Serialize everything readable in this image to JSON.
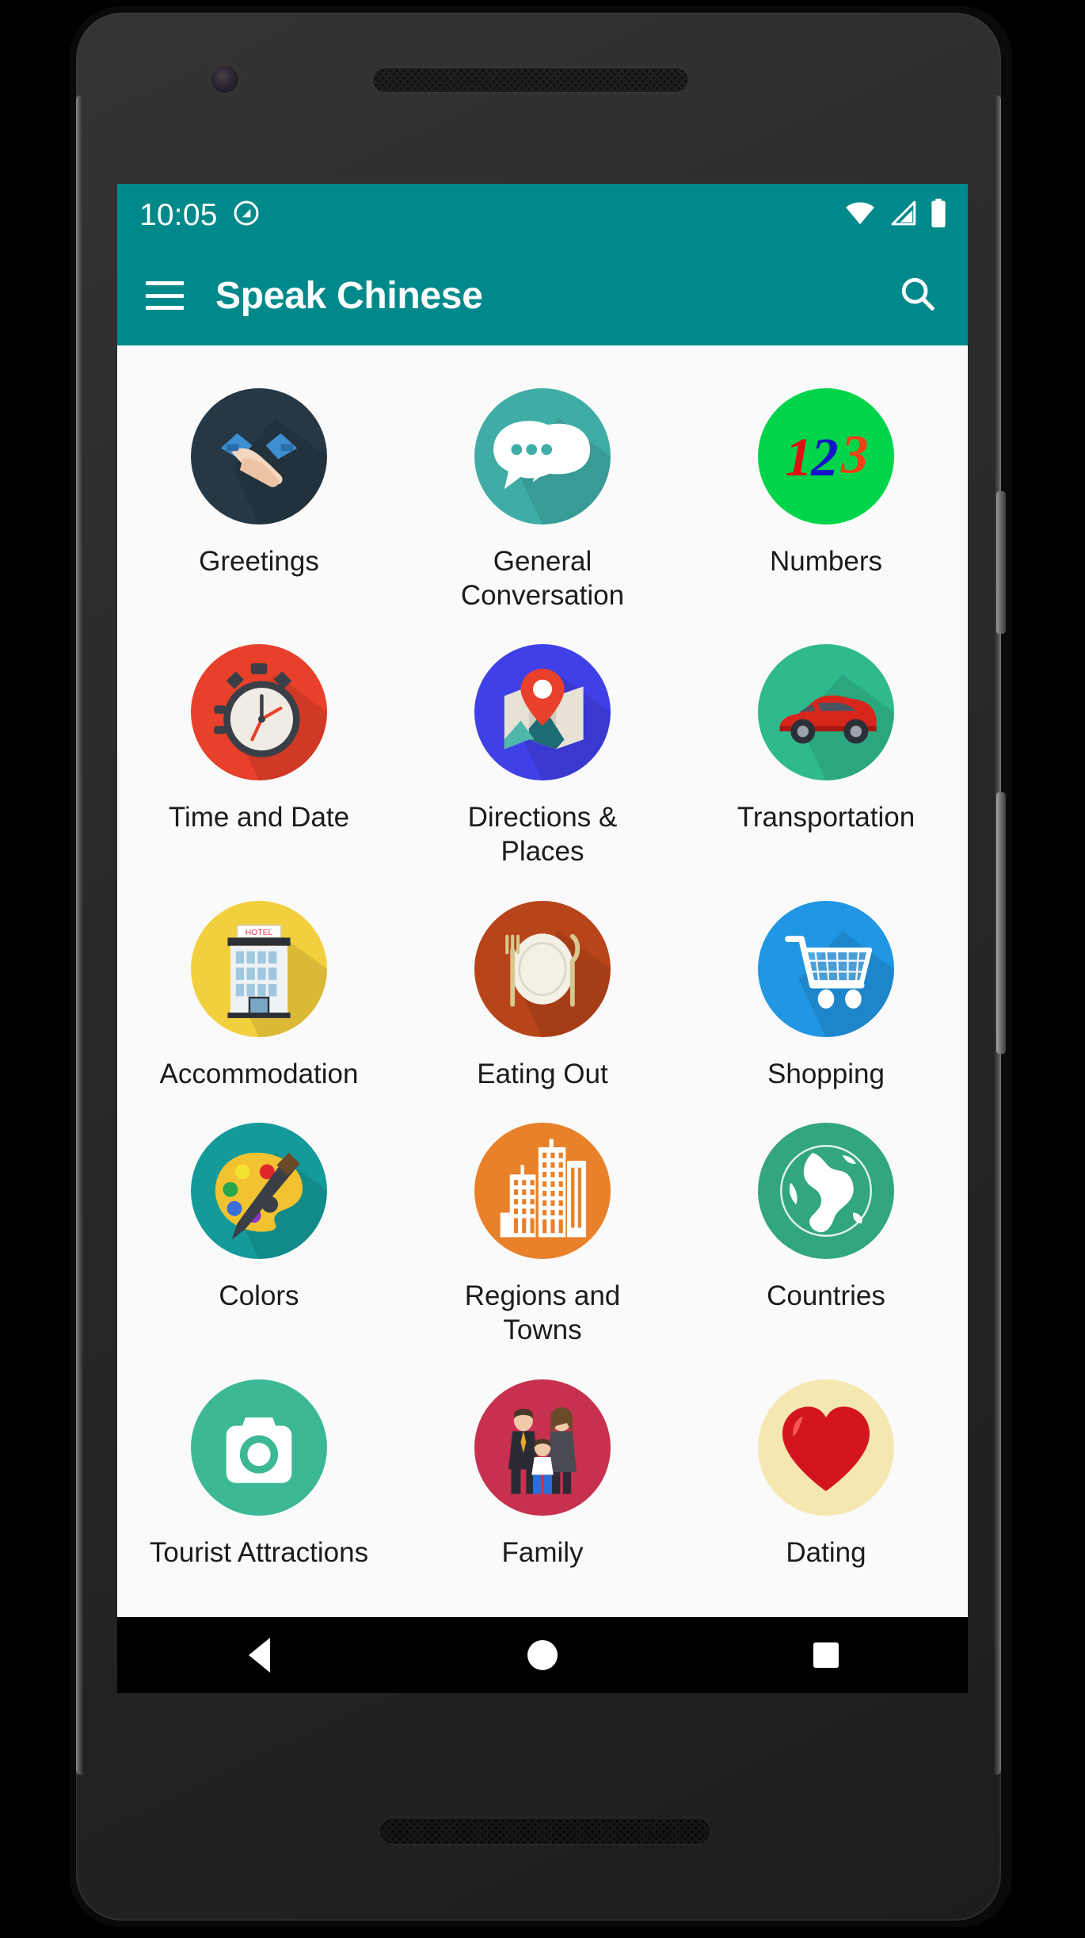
{
  "device": {
    "type": "android-phone",
    "hardware": {
      "front_camera": "front-camera",
      "earpiece": "earpiece-speaker",
      "bottom_speaker": "bottom-speaker",
      "power_button": "power-button",
      "volume_button": "volume-rocker"
    }
  },
  "status_bar": {
    "clock": "10:05",
    "background": "#00898B",
    "left_icons": [
      {
        "name": "do-not-disturb-icon",
        "glyph": "dnd"
      }
    ],
    "right_icons": [
      {
        "name": "wifi-icon",
        "glyph": "wifi"
      },
      {
        "name": "cell-signal-icon",
        "glyph": "signal"
      },
      {
        "name": "battery-icon",
        "glyph": "battery-full"
      }
    ]
  },
  "app_bar": {
    "menu_label": "menu",
    "title": "Speak Chinese",
    "search_label": "search",
    "background": "#00898B",
    "text_color": "#ffffff"
  },
  "main": {
    "background": "#fafafa",
    "columns": 3,
    "tiles": [
      {
        "label": "Greetings",
        "icon": "handshake-icon",
        "bg": "#263845",
        "accent": "#3d8fd1"
      },
      {
        "label": "General Conversation",
        "icon": "chat-bubbles-icon",
        "bg": "#3fada6",
        "accent": "#ffffff"
      },
      {
        "label": "Numbers",
        "icon": "one-two-three-icon",
        "bg": "#00d44a",
        "accent": "#1414c8"
      },
      {
        "label": "Time and Date",
        "icon": "stopwatch-icon",
        "bg": "#e8402a",
        "accent": "#3a3f47"
      },
      {
        "label": "Directions & Places",
        "icon": "map-pin-icon",
        "bg": "#4040e8",
        "accent": "#e8402a"
      },
      {
        "label": "Transportation",
        "icon": "car-icon",
        "bg": "#2fba8e",
        "accent": "#d9261c"
      },
      {
        "label": "Accommodation",
        "icon": "hotel-building-icon",
        "bg": "#f2cf3c",
        "accent": "#9fc7e0"
      },
      {
        "label": "Eating Out",
        "icon": "plate-cutlery-icon",
        "bg": "#b8441a",
        "accent": "#f4f0e6"
      },
      {
        "label": "Shopping",
        "icon": "shopping-cart-icon",
        "bg": "#2196e3",
        "accent": "#ffffff"
      },
      {
        "label": "Colors",
        "icon": "paint-palette-icon",
        "bg": "#159a9a",
        "accent": "#f2c230"
      },
      {
        "label": "Regions and Towns",
        "icon": "city-buildings-icon",
        "bg": "#e8812a",
        "accent": "#ffffff"
      },
      {
        "label": "Countries",
        "icon": "globe-icon",
        "bg": "#32a67e",
        "accent": "#ffffff"
      },
      {
        "label": "Tourist Attractions",
        "icon": "camera-icon",
        "bg": "#3cb894",
        "accent": "#ffffff"
      },
      {
        "label": "Family",
        "icon": "family-icon",
        "bg": "#c8304f",
        "accent": "#2b2b33"
      },
      {
        "label": "Dating",
        "icon": "heart-icon",
        "bg": "#f5e7b0",
        "accent": "#d4151f"
      }
    ]
  },
  "nav_bar": {
    "background": "#000000",
    "buttons": [
      {
        "name": "back-button",
        "glyph": "triangle-left"
      },
      {
        "name": "home-button",
        "glyph": "circle"
      },
      {
        "name": "recents-button",
        "glyph": "square"
      }
    ]
  }
}
